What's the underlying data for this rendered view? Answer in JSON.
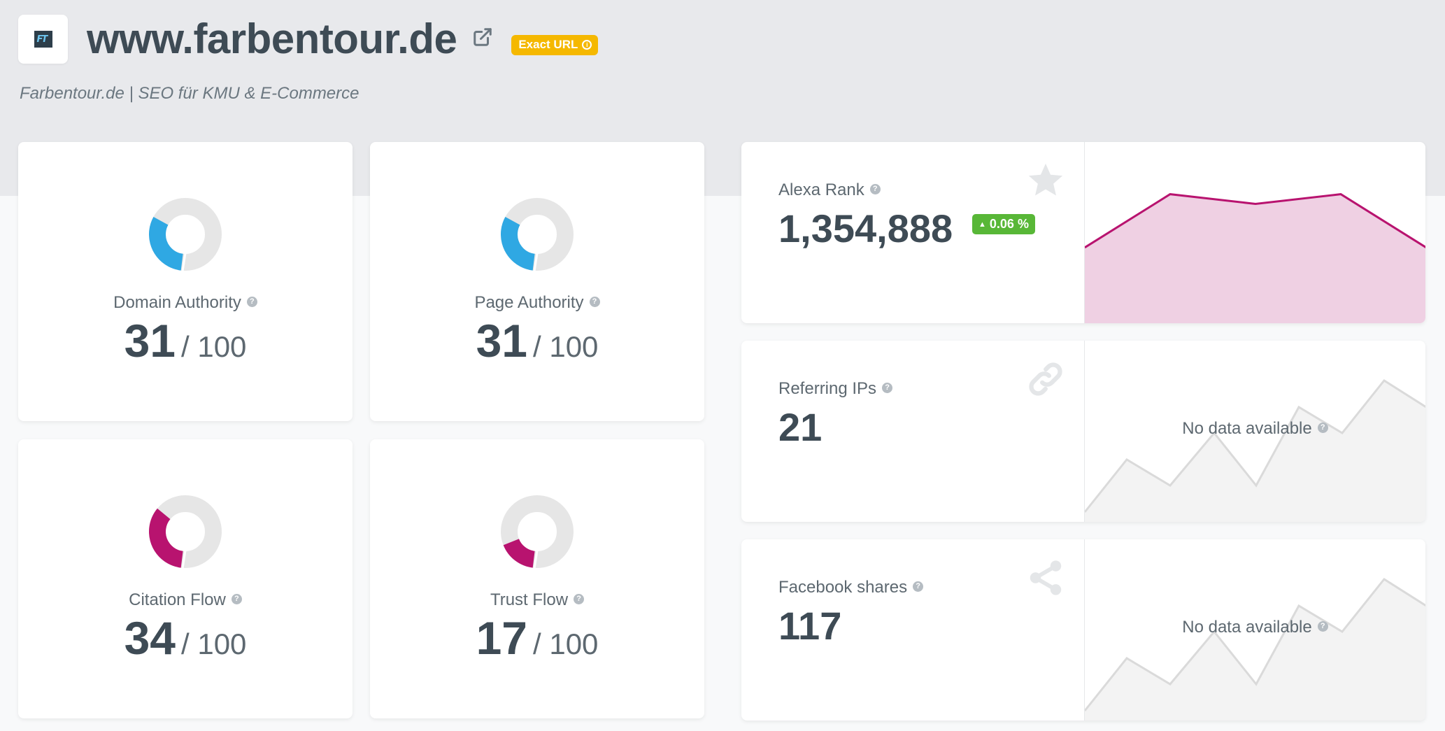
{
  "header": {
    "title": "www.farbentour.de",
    "badge_label": "Exact URL",
    "subtitle": "Farbentour.de | SEO für KMU & E-Commerce"
  },
  "icons": {
    "external_link": "external-link-icon",
    "info": "info-icon",
    "help": "help-icon",
    "star": "star-icon",
    "link": "link-icon",
    "share": "share-icon",
    "arrow_up": "arrow-up-icon"
  },
  "colors": {
    "blue": "#2fa8e3",
    "magenta": "#b8136f",
    "track": "#e6e6e6",
    "badge_yellow": "#f5b800",
    "positive_green": "#58b737",
    "chart_fill": "#efd0e3"
  },
  "metrics": [
    {
      "label": "Domain Authority",
      "value": "31",
      "max": "/ 100",
      "score": 31,
      "color": "#2fa8e3"
    },
    {
      "label": "Page Authority",
      "value": "31",
      "max": "/ 100",
      "score": 31,
      "color": "#2fa8e3"
    },
    {
      "label": "Citation Flow",
      "value": "34",
      "max": "/ 100",
      "score": 34,
      "color": "#b8136f"
    },
    {
      "label": "Trust Flow",
      "value": "17",
      "max": "/ 100",
      "score": 17,
      "color": "#b8136f"
    }
  ],
  "stats": {
    "alexa": {
      "label": "Alexa Rank",
      "value": "1,354,888",
      "change": "0.06 %"
    },
    "referring_ips": {
      "label": "Referring IPs",
      "value": "21",
      "no_data": "No data available"
    },
    "facebook": {
      "label": "Facebook shares",
      "value": "117",
      "no_data": "No data available"
    }
  },
  "chart_data": {
    "type": "area",
    "title": "",
    "xlabel": "",
    "ylabel": "",
    "series": [
      {
        "values": [
          1,
          2.1,
          1.9,
          2.1,
          1
        ]
      }
    ]
  }
}
